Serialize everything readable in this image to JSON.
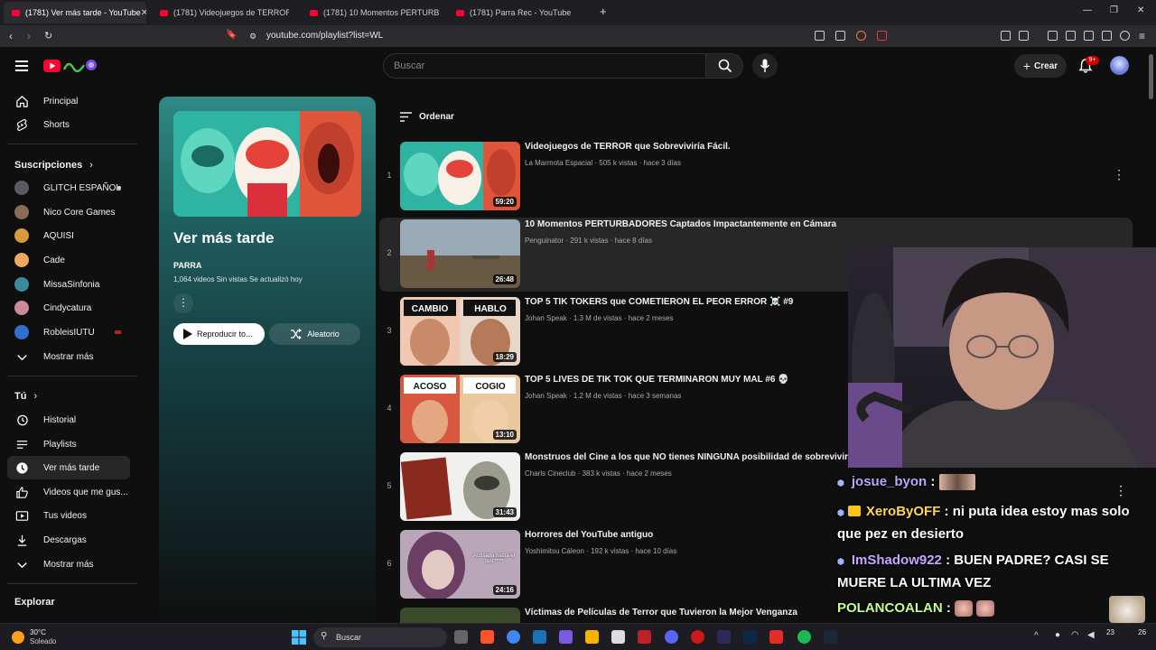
{
  "browser": {
    "tabs": [
      {
        "title": "(1781) Ver más tarde - YouTube",
        "active": true
      },
      {
        "title": "(1781) Videojuegos de TERROR que",
        "active": false
      },
      {
        "title": "(1781) 10 Momentos PERTURBADOR",
        "active": false
      },
      {
        "title": "(1781) Parra Rec - YouTube",
        "active": false
      }
    ],
    "url": "youtube.com/playlist?list=WL"
  },
  "header": {
    "search_placeholder": "Buscar",
    "create_label": "Crear",
    "notifications": "9+"
  },
  "sidebar": {
    "main": [
      {
        "label": "Principal",
        "icon": "home-icon"
      },
      {
        "label": "Shorts",
        "icon": "shorts-icon"
      }
    ],
    "subscriptions_title": "Suscripciones",
    "subscriptions": [
      {
        "label": "GLITCH ESPAÑOL",
        "color": "#5a5a66",
        "live": true
      },
      {
        "label": "Nico Core Games",
        "color": "#8a6b55"
      },
      {
        "label": "AQUISI",
        "color": "#d99a3a"
      },
      {
        "label": "Cade",
        "color": "#f0a860"
      },
      {
        "label": "MissaSinfonia",
        "color": "#3a8a9c"
      },
      {
        "label": "Cindycatura",
        "color": "#c98a9a"
      },
      {
        "label": "RobleisIUTU",
        "color": "#2f6fd0"
      },
      {
        "label": "Mostrar más",
        "icon": "chevron-down-icon"
      }
    ],
    "you_title": "Tú",
    "you": [
      {
        "label": "Historial",
        "icon": "history-icon"
      },
      {
        "label": "Playlists",
        "icon": "playlists-icon"
      },
      {
        "label": "Ver más tarde",
        "icon": "watch-later-icon",
        "active": true
      },
      {
        "label": "Videos que me gus...",
        "icon": "thumbs-up-icon"
      },
      {
        "label": "Tus videos",
        "icon": "your-videos-icon"
      },
      {
        "label": "Descargas",
        "icon": "download-icon"
      },
      {
        "label": "Mostrar más",
        "icon": "chevron-down-icon"
      }
    ],
    "explore_title": "Explorar"
  },
  "playlist": {
    "title": "Ver más tarde",
    "owner": "PARRA",
    "meta": "1,064 videos   Sin vistas   Se actualizó hoy",
    "play_label": "Reproducir to...",
    "shuffle_label": "Aleatorio"
  },
  "sort_label": "Ordenar",
  "videos": [
    {
      "index": "1",
      "title": "Videojuegos de TERROR que Sobreviviría Fácil.",
      "channel": "La Marmota Espacial",
      "meta": "La Marmota Espacial · 505 k vistas · hace 3 días",
      "duration": "59:20",
      "colors": [
        "#2fb3a3",
        "#e0553a"
      ]
    },
    {
      "index": "2",
      "title": "10 Momentos PERTURBADORES Captados Impactantemente en Cámara",
      "channel": "Penguinator",
      "meta": "Penguinator · 291 k vistas · hace 8 días",
      "duration": "26:48",
      "colors": [
        "#8fa0ae",
        "#6a5a44"
      ]
    },
    {
      "index": "3",
      "title": "TOP 5 TIK TOKERS que COMETIERON EL PEOR ERROR ☠️ #9",
      "channel": "Johan Speak",
      "meta": "Johan Speak · 1.3 M de vistas · hace 2 meses",
      "duration": "18:29",
      "colors": [
        "#c94a4a",
        "#e8b190"
      ]
    },
    {
      "index": "4",
      "title": "TOP 5 LIVES DE TIK TOK QUE TERMINARON MUY MAL #6 💀",
      "channel": "Johan Speak",
      "meta": "Johan Speak · 1.2 M de vistas · hace 3 semanas",
      "duration": "13:10",
      "colors": [
        "#d8583f",
        "#e9c79f"
      ]
    },
    {
      "index": "5",
      "title": "Monstruos del Cine a los que NO tienes NINGUNA posibilidad de sobrevivir",
      "channel": "Charls Cineclub",
      "meta": "Charls Cineclub · 383 k vistas · hace 2 meses",
      "duration": "31:43",
      "colors": [
        "#8a2a1f",
        "#9b9b8f"
      ]
    },
    {
      "index": "6",
      "title": "Horrores del YouTube antiguo",
      "channel": "Yoshimitsu Cáleon",
      "meta": "Yoshimitsu Cáleon · 192 k vistas · hace 10 días",
      "duration": "24:16",
      "colors": [
        "#b9a7b9",
        "#6a3f63"
      ],
      "overlay_text": "Acosada hasta el suic****"
    },
    {
      "index": "7",
      "title": "Víctimas de Películas de Terror que Tuvieron la Mejor Venganza",
      "meta": "",
      "duration": "",
      "colors": [
        "#3a4a2a",
        "#5a6a3a"
      ]
    }
  ],
  "chat": [
    {
      "user": "josue_byon",
      "text": "",
      "emotes": 1
    },
    {
      "user": "XeroByOFF",
      "text": "ni puta idea estoy mas solo que pez en desierto"
    },
    {
      "user": "ImShadow922",
      "text": "BUEN PADRE? CASI SE MUERE LA ULTIMA VEZ"
    },
    {
      "user": "POLANCOALAN",
      "text": "",
      "emotes": 2
    },
    {
      "user": "ImShadow922",
      "text": "",
      "emotes": 1
    }
  ],
  "taskbar": {
    "temp": "30°C",
    "weather": "Soleado",
    "search_label": "Buscar",
    "time": "23",
    "time2": "26"
  },
  "colors": {
    "brand_red": "#ff0033",
    "accent_teal": "#2f8a86"
  }
}
